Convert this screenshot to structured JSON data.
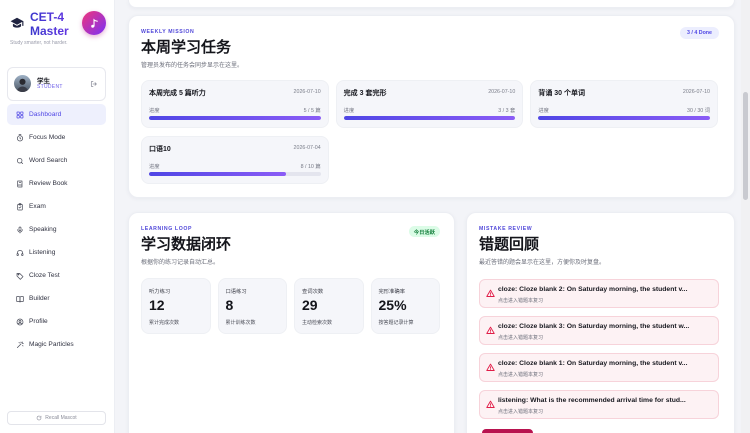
{
  "theme": {
    "accent": "#4f46e5",
    "accent_alt": "#8b5cf6",
    "danger": "#e11d48",
    "success": "#15803d",
    "music_gradient_start": "#f0367a",
    "music_gradient_end": "#7b2ff7"
  },
  "sidebar": {
    "brand": "CET-4 Master",
    "tagline": "Study smarter, not harder.",
    "logo_icon": "graduation-cap-icon",
    "music_button_icon": "music-note-icon",
    "user": {
      "name": "学生",
      "role": "STUDENT",
      "logout_icon": "logout-icon"
    },
    "nav": [
      {
        "label": "Dashboard",
        "icon": "dashboard-grid-icon",
        "active": true
      },
      {
        "label": "Focus Mode",
        "icon": "timer-icon",
        "active": false
      },
      {
        "label": "Word Search",
        "icon": "search-icon",
        "active": false
      },
      {
        "label": "Review Book",
        "icon": "book-icon",
        "active": false
      },
      {
        "label": "Exam",
        "icon": "clipboard-check-icon",
        "active": false
      },
      {
        "label": "Speaking",
        "icon": "microphone-icon",
        "active": false
      },
      {
        "label": "Listening",
        "icon": "headphones-icon",
        "active": false
      },
      {
        "label": "Cloze Test",
        "icon": "tag-icon",
        "active": false
      },
      {
        "label": "Builder",
        "icon": "open-book-icon",
        "active": false
      },
      {
        "label": "Profile",
        "icon": "user-circle-icon",
        "active": false
      },
      {
        "label": "Magic Particles",
        "icon": "magic-wand-icon",
        "active": false
      }
    ],
    "mascot_button": {
      "label": "Recall Mascot",
      "icon": "refresh-icon"
    }
  },
  "weekly_mission": {
    "eyebrow": "WEEKLY MISSION",
    "title": "本周学习任务",
    "subtitle": "管理员发布的任务会同步显示在这里。",
    "badge": "3 / 4 Done",
    "tasks": [
      {
        "title": "本周完成 5 篇听力",
        "date": "2026-07-10",
        "progress_label": "进度",
        "progress_text": "5 / 5 篇",
        "progress": 1.0
      },
      {
        "title": "完成 3 套完形",
        "date": "2026-07-10",
        "progress_label": "进度",
        "progress_text": "3 / 3 套",
        "progress": 1.0
      },
      {
        "title": "背诵 30 个单词",
        "date": "2026-07-10",
        "progress_label": "进度",
        "progress_text": "30 / 30 词",
        "progress": 1.0
      },
      {
        "title": "口语10",
        "date": "2026-07-04",
        "progress_label": "进度",
        "progress_text": "8 / 10 篇",
        "progress": 0.8
      }
    ]
  },
  "learning_loop": {
    "eyebrow": "LEARNING LOOP",
    "title": "学习数据闭环",
    "subtitle": "根据你的练习记录自动汇总。",
    "badge": "今日活跃",
    "stats": [
      {
        "label": "听力练习",
        "value": "12",
        "caption": "累计完成次数"
      },
      {
        "label": "口语练习",
        "value": "8",
        "caption": "累计训练次数"
      },
      {
        "label": "查词次数",
        "value": "29",
        "caption": "主动检索次数"
      },
      {
        "label": "完形准确率",
        "value": "25%",
        "caption": "按答题记录计算"
      }
    ]
  },
  "mistake_review": {
    "eyebrow": "MISTAKE REVIEW",
    "title": "错题回顾",
    "subtitle": "最近答错的题会显示在这里，方便你及时复盘。",
    "item_icon": "warning-triangle-icon",
    "items": [
      {
        "title": "cloze: Cloze blank 2: On Saturday morning, the student v...",
        "hint": "点击进入错题本复习"
      },
      {
        "title": "cloze: Cloze blank 3: On Saturday morning, the student w...",
        "hint": "点击进入错题本复习"
      },
      {
        "title": "cloze: Cloze blank 1: On Saturday morning, the student v...",
        "hint": "点击进入错题本复习"
      },
      {
        "title": "listening: What is the recommended arrival time for stud...",
        "hint": "点击进入错题本复习"
      }
    ]
  }
}
